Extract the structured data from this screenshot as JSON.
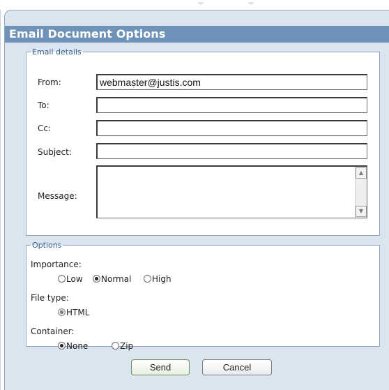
{
  "dialog": {
    "title": "Email Document Options"
  },
  "email_details": {
    "legend": "Email details",
    "from": {
      "label": "From:",
      "value": "webmaster@justis.com"
    },
    "to": {
      "label": "To:",
      "value": ""
    },
    "cc": {
      "label": "Cc:",
      "value": ""
    },
    "subject": {
      "label": "Subject:",
      "value": ""
    },
    "message": {
      "label": "Message:",
      "value": ""
    }
  },
  "options": {
    "legend": "Options",
    "importance": {
      "label": "Importance:",
      "choices": [
        "Low",
        "Normal",
        "High"
      ],
      "selected": "Normal"
    },
    "file_type": {
      "label": "File type:",
      "choices": [
        "HTML"
      ],
      "selected": "HTML"
    },
    "container": {
      "label": "Container:",
      "choices": [
        "None",
        "Zip"
      ],
      "selected": "None"
    }
  },
  "buttons": {
    "send": "Send",
    "cancel": "Cancel"
  },
  "colors": {
    "title_bar": "#6f92b8",
    "dialog_bg": "#dbe5ef",
    "legend_text": "#2f5d8c"
  }
}
